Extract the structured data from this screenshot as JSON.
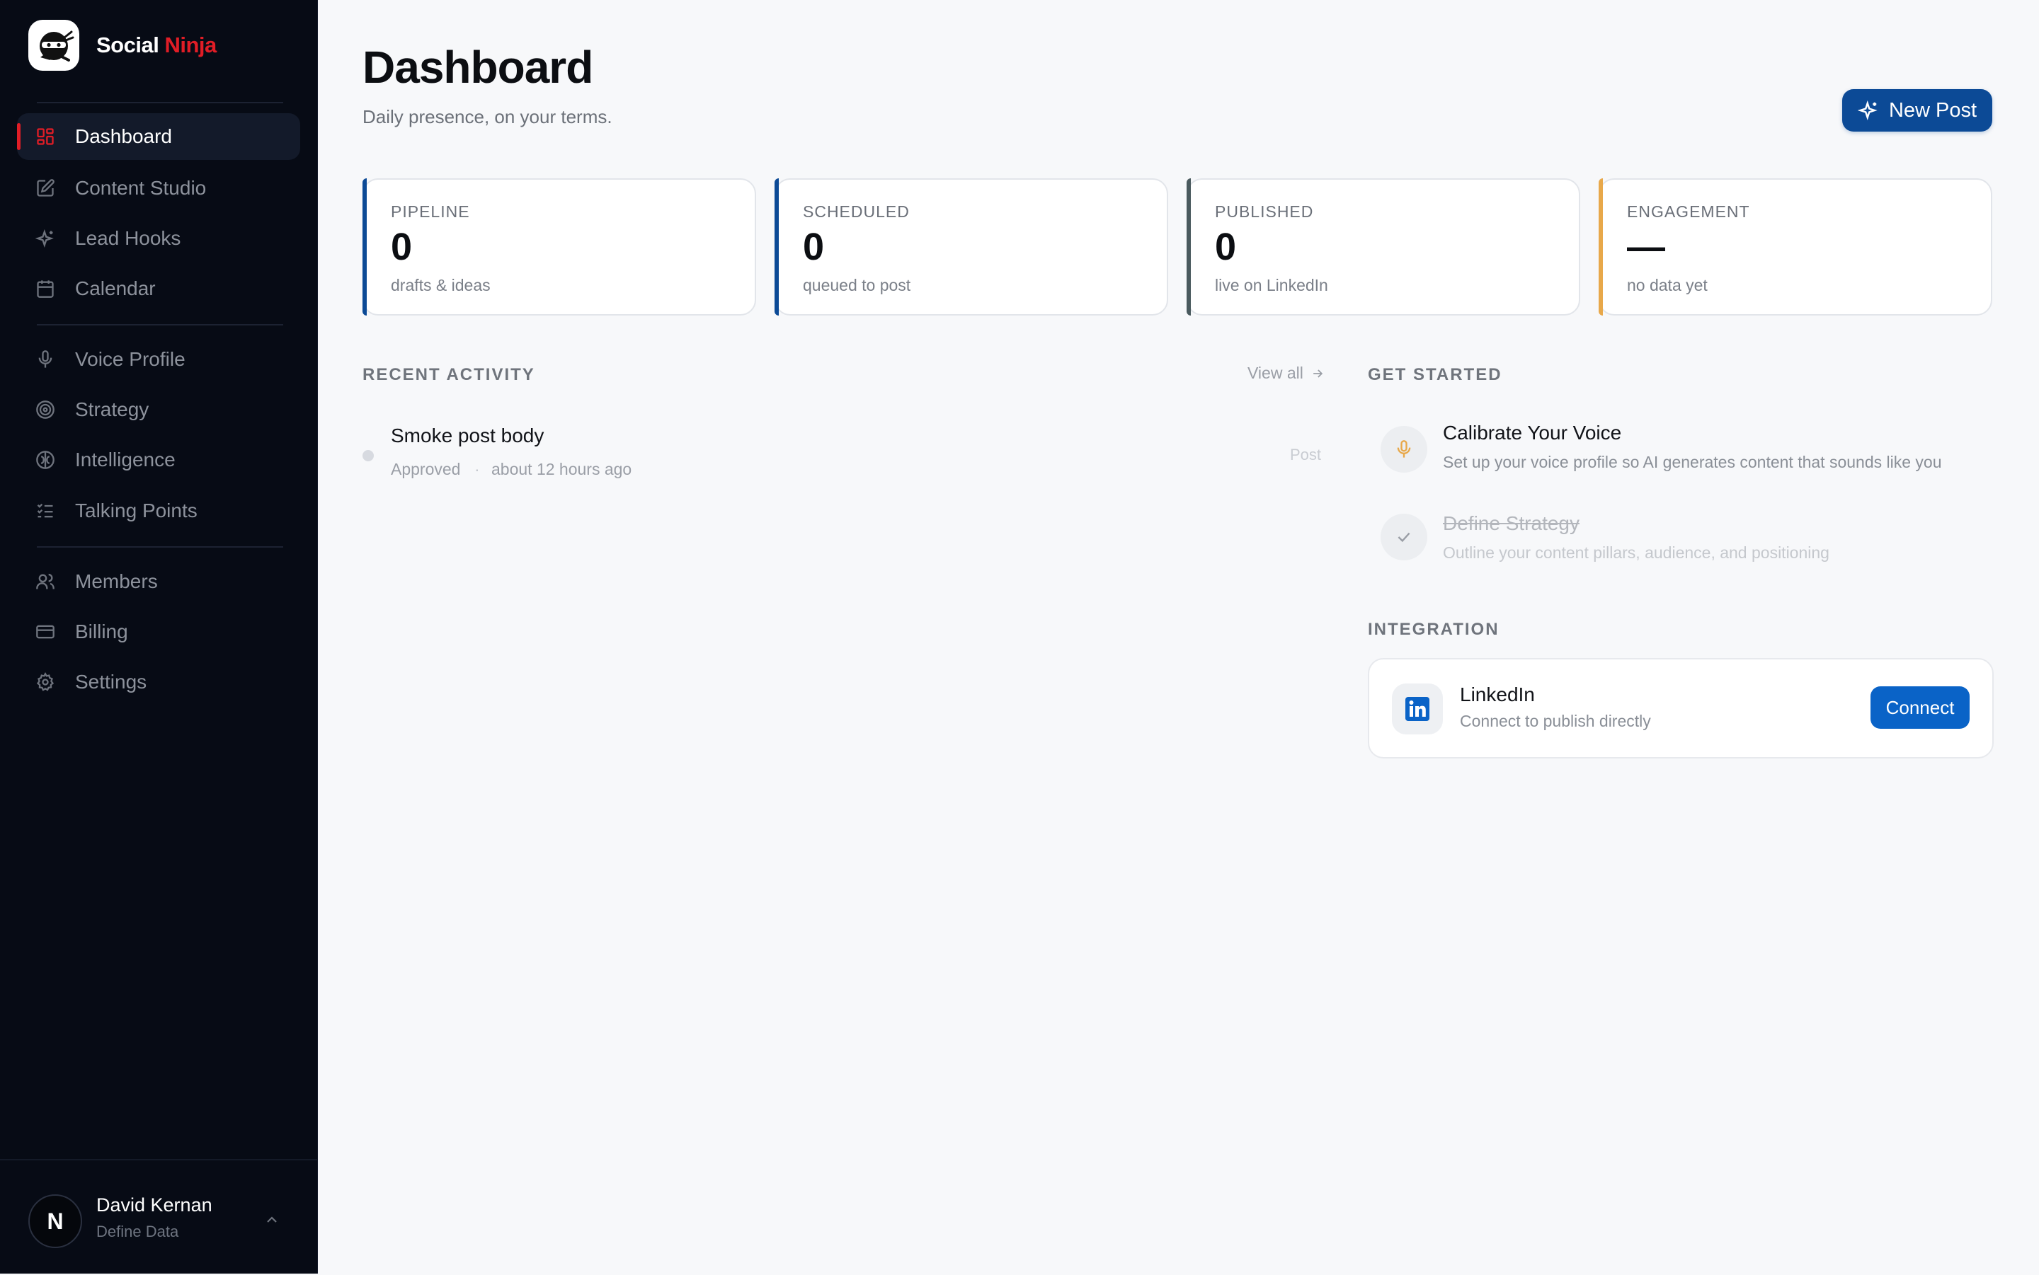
{
  "app": {
    "name_part1": "Social",
    "name_part2": "Ninja",
    "brand_accent": "#e11d26"
  },
  "sidebar": {
    "items": [
      {
        "label": "Dashboard",
        "icon": "grid-icon",
        "active": true
      },
      {
        "label": "Content Studio",
        "icon": "edit-icon"
      },
      {
        "label": "Lead Hooks",
        "icon": "sparkles-icon"
      },
      {
        "label": "Calendar",
        "icon": "calendar-icon"
      },
      {
        "label": "Voice Profile",
        "icon": "microphone-icon"
      },
      {
        "label": "Strategy",
        "icon": "target-icon"
      },
      {
        "label": "Intelligence",
        "icon": "brain-icon"
      },
      {
        "label": "Talking Points",
        "icon": "checklist-icon"
      },
      {
        "label": "Members",
        "icon": "users-icon"
      },
      {
        "label": "Billing",
        "icon": "credit-card-icon"
      },
      {
        "label": "Settings",
        "icon": "gear-icon"
      }
    ]
  },
  "user": {
    "initial": "N",
    "name": "David Kernan",
    "org": "Define Data"
  },
  "header": {
    "title": "Dashboard",
    "subtitle": "Daily presence, on your terms.",
    "new_post_label": "New Post"
  },
  "stats": [
    {
      "label": "PIPELINE",
      "value": "0",
      "note": "drafts & ideas",
      "accent": "#0c4a96"
    },
    {
      "label": "SCHEDULED",
      "value": "0",
      "note": "queued to post",
      "accent": "#0c4a96"
    },
    {
      "label": "PUBLISHED",
      "value": "0",
      "note": "live on LinkedIn",
      "accent": "#4a5a5e"
    },
    {
      "label": "ENGAGEMENT",
      "value": "—",
      "note": "no data yet",
      "accent": "#e8a84a"
    }
  ],
  "recent_activity": {
    "heading": "RECENT ACTIVITY",
    "view_all": "View all",
    "items": [
      {
        "title": "Smoke post body",
        "status": "Approved",
        "separator": "·",
        "time": "about 12 hours ago",
        "type": "Post"
      }
    ]
  },
  "get_started": {
    "heading": "GET STARTED",
    "steps": [
      {
        "title": "Calibrate Your Voice",
        "desc": "Set up your voice profile so AI generates content that sounds like you",
        "done": false,
        "icon": "microphone-icon"
      },
      {
        "title": "Define Strategy",
        "desc": "Outline your content pillars, audience, and positioning",
        "done": true,
        "icon": "check-icon"
      }
    ]
  },
  "integration": {
    "heading": "INTEGRATION",
    "name": "LinkedIn",
    "desc": "Connect to publish directly",
    "button": "Connect",
    "icon": "linkedin-icon"
  }
}
